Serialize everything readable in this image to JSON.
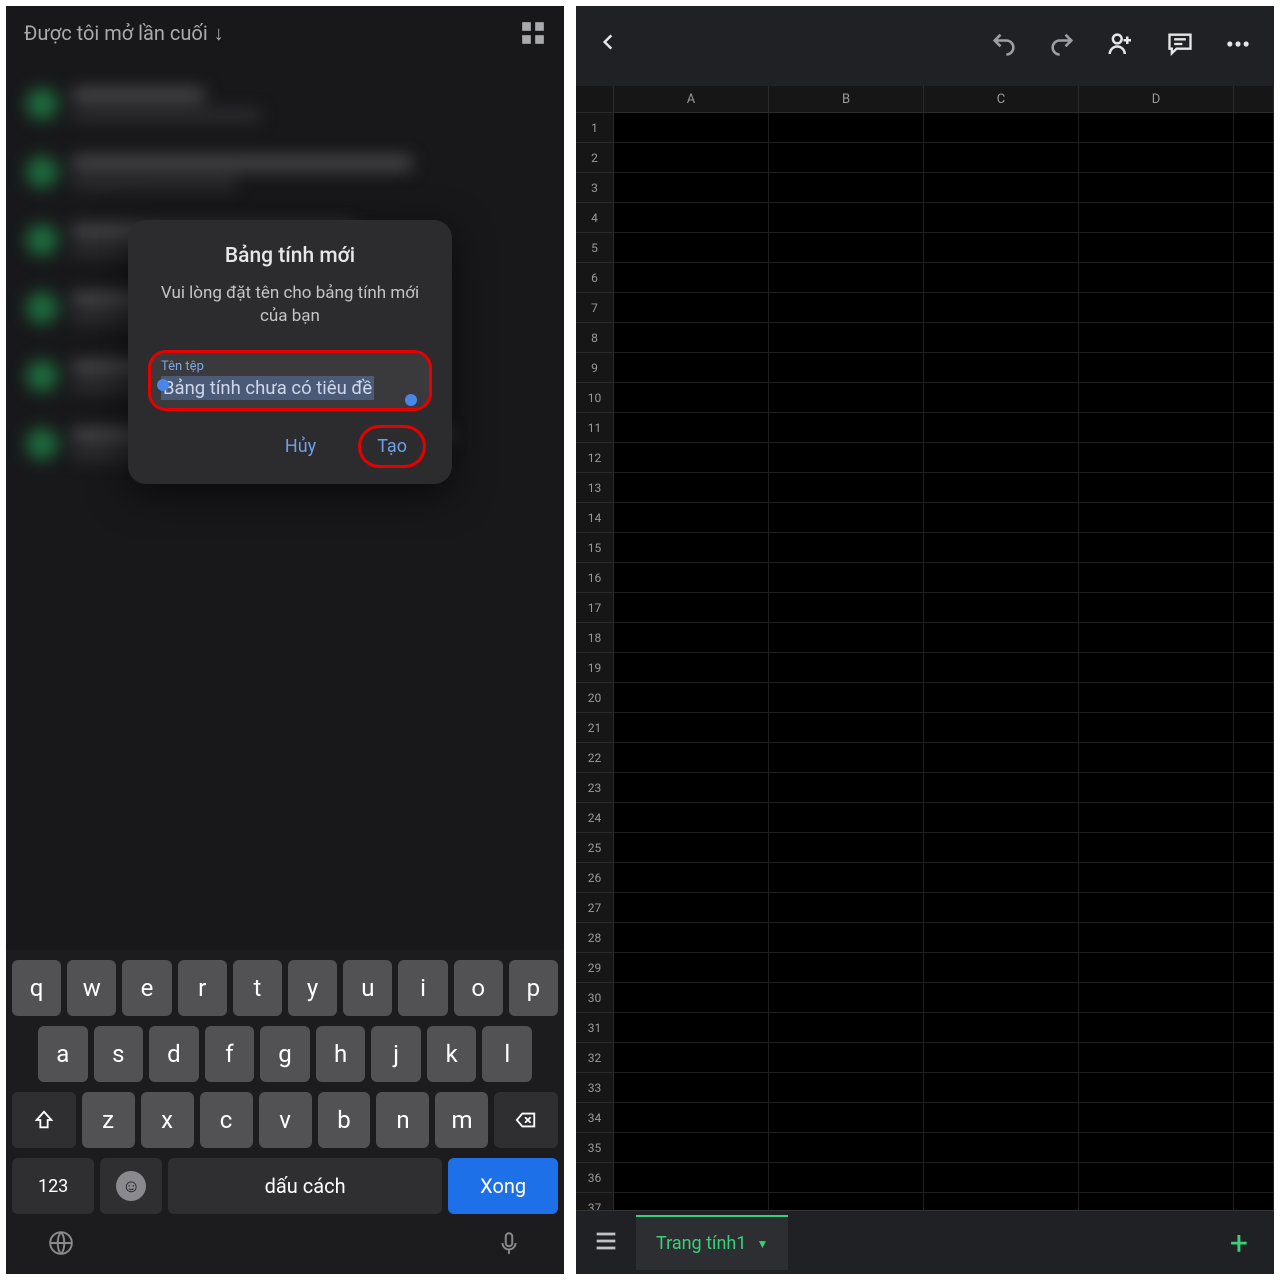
{
  "left": {
    "sort_label": "Được tôi mở lần cuối",
    "dialog": {
      "title": "Bảng tính mới",
      "subtitle": "Vui lòng đặt tên cho bảng tính mới của bạn",
      "field_label": "Tên tệp",
      "field_value": "Bảng tính chưa có tiêu đề",
      "cancel": "Hủy",
      "create": "Tạo"
    },
    "keyboard": {
      "row1": [
        "q",
        "w",
        "e",
        "r",
        "t",
        "y",
        "u",
        "i",
        "o",
        "p"
      ],
      "row2": [
        "a",
        "s",
        "d",
        "f",
        "g",
        "h",
        "j",
        "k",
        "l"
      ],
      "row3": [
        "z",
        "x",
        "c",
        "v",
        "b",
        "n",
        "m"
      ],
      "numbers": "123",
      "space": "dấu cách",
      "done": "Xong"
    }
  },
  "right": {
    "columns": [
      "A",
      "B",
      "C",
      "D"
    ],
    "row_count": 38,
    "sheet_name": "Trang tính1"
  }
}
